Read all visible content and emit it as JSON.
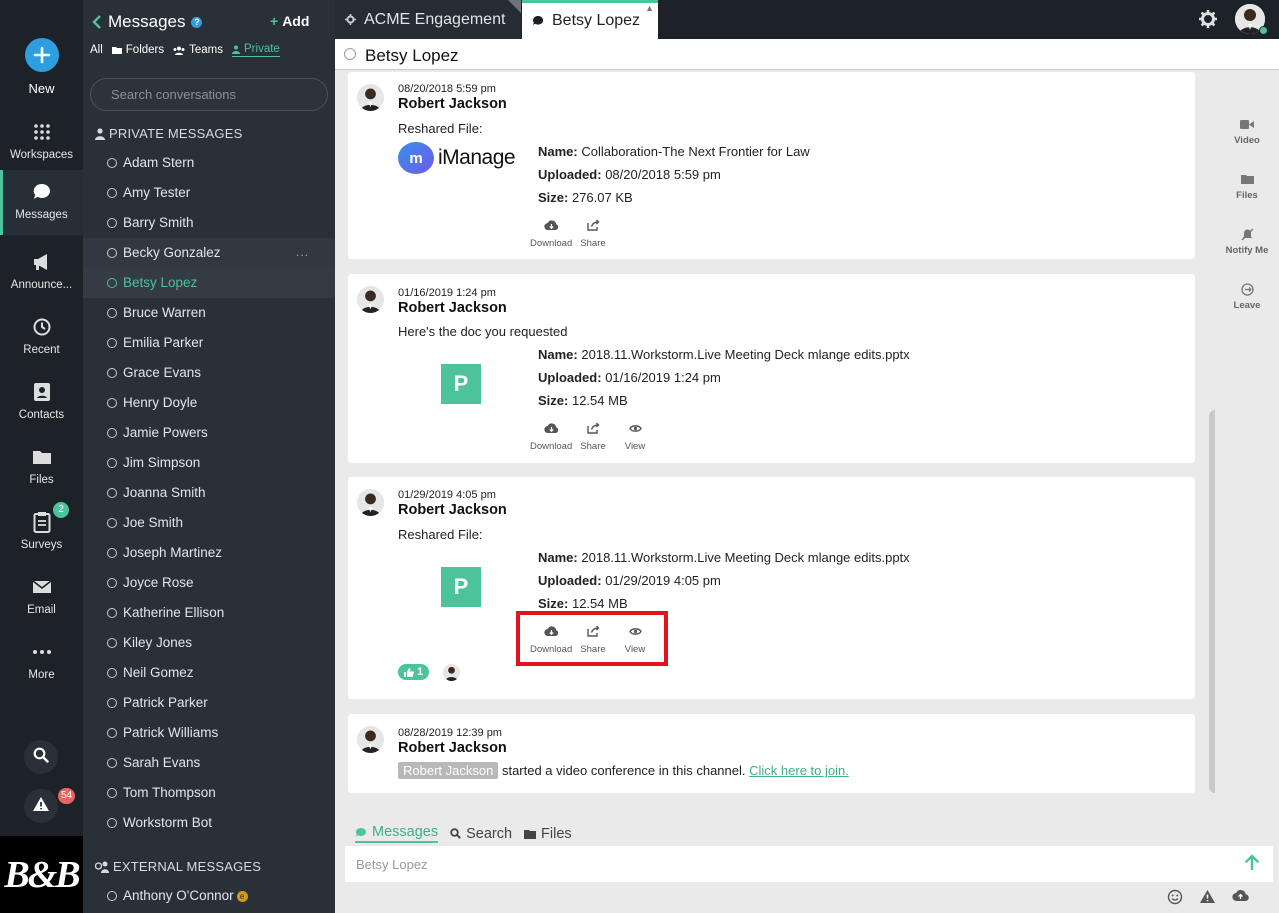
{
  "rail": {
    "new_label": "New",
    "items": [
      {
        "label": "Workspaces",
        "icon": "grid-icon"
      },
      {
        "label": "Messages",
        "icon": "chat-icon"
      },
      {
        "label": "Announce...",
        "icon": "megaphone-icon"
      },
      {
        "label": "Recent",
        "icon": "history-icon"
      },
      {
        "label": "Contacts",
        "icon": "contacts-icon"
      },
      {
        "label": "Files",
        "icon": "folder-icon"
      },
      {
        "label": "Surveys",
        "icon": "clipboard-icon"
      },
      {
        "label": "Email",
        "icon": "mail-icon"
      },
      {
        "label": "More",
        "icon": "more-icon"
      }
    ],
    "surveys_badge": "2",
    "alerts_badge": "54",
    "logo_text": "B&B"
  },
  "panel": {
    "title": "Messages",
    "add_label": "Add",
    "filters": {
      "all": "All",
      "folders": "Folders",
      "teams": "Teams",
      "private": "Private"
    },
    "search_placeholder": "Search conversations",
    "private_header": "PRIVATE MESSAGES",
    "external_header": "EXTERNAL MESSAGES",
    "conversations": [
      "Adam Stern",
      "Amy Tester",
      "Barry Smith",
      "Becky Gonzalez",
      "Betsy Lopez",
      "Bruce Warren",
      "Emilia Parker",
      "Grace Evans",
      "Henry Doyle",
      "Jamie Powers",
      "Jim Simpson",
      "Joanna Smith",
      "Joe Smith",
      "Joseph Martinez",
      "Joyce Rose",
      "Katherine Ellison",
      "Kiley Jones",
      "Neil Gomez",
      "Patrick Parker",
      "Patrick Williams",
      "Sarah Evans",
      "Tom Thompson",
      "Workstorm Bot"
    ],
    "external": [
      "Anthony O'Connor"
    ],
    "more_dots": "..."
  },
  "tabs": {
    "inactive": "ACME Engagement",
    "active": "Betsy Lopez"
  },
  "channel": {
    "name": "Betsy Lopez"
  },
  "messages": [
    {
      "timestamp": "08/20/2018 5:59 pm",
      "author": "Robert Jackson",
      "text": "Reshared File:",
      "logo_word": "iManage",
      "logo_mark": "m",
      "file": {
        "name_label": "Name:",
        "name": "Collaboration-The Next Frontier for Law",
        "uploaded_label": "Uploaded:",
        "uploaded": "08/20/2018 5:59 pm",
        "size_label": "Size:",
        "size": "276.07 KB"
      },
      "actions": [
        "Download",
        "Share"
      ]
    },
    {
      "timestamp": "01/16/2019 1:24 pm",
      "author": "Robert Jackson",
      "text": "Here's the doc you requested",
      "thumb": "P",
      "file": {
        "name_label": "Name:",
        "name": "2018.11.Workstorm.Live Meeting Deck mlange edits.pptx",
        "uploaded_label": "Uploaded:",
        "uploaded": "01/16/2019 1:24 pm",
        "size_label": "Size:",
        "size": "12.54 MB"
      },
      "actions": [
        "Download",
        "Share",
        "View"
      ]
    },
    {
      "timestamp": "01/29/2019 4:05 pm",
      "author": "Robert Jackson",
      "text": "Reshared File:",
      "thumb": "P",
      "file": {
        "name_label": "Name:",
        "name": "2018.11.Workstorm.Live Meeting Deck mlange edits.pptx",
        "uploaded_label": "Uploaded:",
        "uploaded": "01/29/2019 4:05 pm",
        "size_label": "Size:",
        "size": "12.54 MB"
      },
      "actions": [
        "Download",
        "Share",
        "View"
      ],
      "reaction_count": "1"
    },
    {
      "timestamp": "08/28/2019 12:39 pm",
      "author": "Robert Jackson",
      "chip": "Robert Jackson",
      "text": "started a video conference in this channel.",
      "link": "Click here to join."
    }
  ],
  "side_actions": [
    "Video",
    "Files",
    "Notify Me",
    "Leave"
  ],
  "composer": {
    "tabs": [
      "Messages",
      "Search",
      "Files"
    ],
    "placeholder": "Betsy Lopez"
  },
  "colors": {
    "accent": "#4cc39b",
    "rail": "#1d2229",
    "panel": "#2a3038",
    "highlight": "#e3131b",
    "brand_blue": "#2d9fe0"
  }
}
